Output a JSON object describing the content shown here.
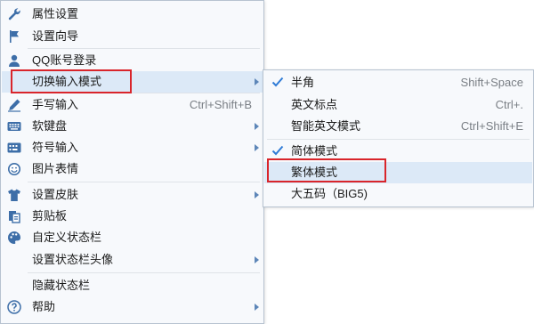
{
  "main_menu": {
    "items": [
      {
        "label": "属性设置",
        "icon": "wrench-icon"
      },
      {
        "label": "设置向导",
        "icon": "flag-icon"
      },
      {
        "label": "QQ账号登录",
        "icon": "user-icon"
      },
      {
        "label": "切换输入模式",
        "has_submenu": true
      },
      {
        "label": "手写输入",
        "icon": "pen-icon",
        "shortcut": "Ctrl+Shift+B"
      },
      {
        "label": "软键盘",
        "icon": "keyboard-icon",
        "has_submenu": true
      },
      {
        "label": "符号输入",
        "icon": "symbol-icon",
        "has_submenu": true
      },
      {
        "label": "图片表情",
        "icon": "smiley-icon"
      },
      {
        "label": "设置皮肤",
        "icon": "shirt-icon",
        "has_submenu": true
      },
      {
        "label": "剪贴板",
        "icon": "clipboard-icon"
      },
      {
        "label": "自定义状态栏",
        "icon": "palette-icon"
      },
      {
        "label": "设置状态栏头像",
        "has_submenu": true
      },
      {
        "label": "隐藏状态栏"
      },
      {
        "label": "帮助",
        "icon": "help-icon",
        "has_submenu": true
      }
    ]
  },
  "sub_menu": {
    "items": [
      {
        "label": "半角",
        "shortcut": "Shift+Space",
        "checked": true
      },
      {
        "label": "英文标点",
        "shortcut": "Ctrl+."
      },
      {
        "label": "智能英文模式",
        "shortcut": "Ctrl+Shift+E"
      },
      {
        "label": "简体模式",
        "checked": true
      },
      {
        "label": "繁体模式"
      },
      {
        "label": "大五码（BIG5)"
      }
    ]
  },
  "colors": {
    "highlight": "#dce9f7",
    "icon_blue": "#3d6ea8",
    "check_blue": "#2f7bd6",
    "callout_red": "#d9252b"
  }
}
